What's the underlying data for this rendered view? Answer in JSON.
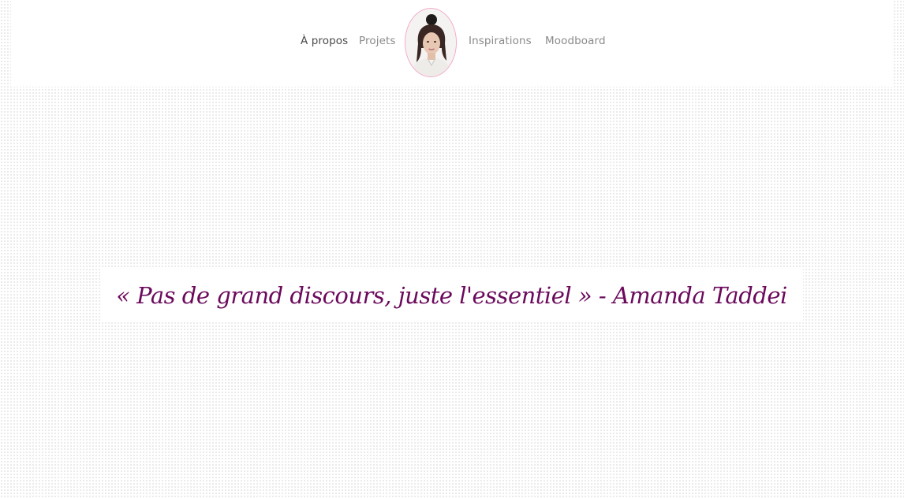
{
  "nav": {
    "left_items": [
      {
        "label": "À propos",
        "active": true
      },
      {
        "label": "Projets",
        "active": false
      }
    ],
    "right_items": [
      {
        "label": "Inspirations",
        "active": false
      },
      {
        "label": "Moodboard",
        "active": false
      }
    ],
    "avatar_icon": "profile-photo"
  },
  "hero": {
    "quote": "« Pas de grand discours, juste l'essentiel » - Amanda Taddei"
  },
  "colors": {
    "accent": "#6b0a5c",
    "avatar_border": "#f3a6c8",
    "nav_text": "#8a8a8a",
    "nav_active": "#4a4a4a"
  }
}
